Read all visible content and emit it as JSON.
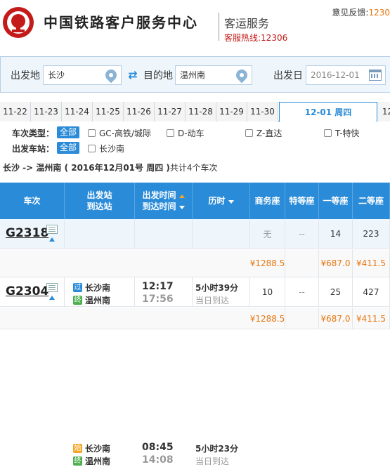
{
  "header": {
    "brand": "中国铁路客户服务中心",
    "sub_title": "客运服务",
    "hotline": "客服热线:12306",
    "feedback_label": "意见反馈:",
    "feedback_value": "1230"
  },
  "search": {
    "from_label": "出发地",
    "from_value": "长沙",
    "to_label": "目的地",
    "to_value": "温州南",
    "date_label": "出发日",
    "date_value": "2016-12-01",
    "swap_icon": "⇄"
  },
  "date_tabs": [
    "11-22",
    "11-23",
    "11-24",
    "11-25",
    "11-26",
    "11-27",
    "11-28",
    "11-29",
    "11-30",
    "12-01  周四",
    "12"
  ],
  "filters": {
    "type_title": "车次类型：",
    "type_all": "全部",
    "type_options": [
      "GC-高铁/城际",
      "D-动车",
      "Z-直达",
      "T-特快"
    ],
    "station_title": "出发车站：",
    "station_all": "全部",
    "station_options": [
      "长沙南"
    ]
  },
  "summary": {
    "route": "长沙 -> 温州南 ( 2016年12月01号  周四 )",
    "count": "共计4个车次"
  },
  "table": {
    "headers": {
      "train": "车次",
      "station_1": "出发站",
      "station_2": "到达站",
      "time_1": "出发时间",
      "time_2": "到达时间",
      "duration": "历时",
      "business": "商务座",
      "premium": "特等座",
      "first": "一等座",
      "second": "二等座"
    },
    "rows": [
      {
        "train": "G2318",
        "from_badge": "始",
        "from": "长沙南",
        "to_badge": "终",
        "to": "温州南",
        "depart": "08:45",
        "arrive": "14:08",
        "duration": "5小时23分",
        "arrival_day": "当日到达",
        "business": "无",
        "premium": "--",
        "first": "14",
        "second": "223",
        "prices": {
          "business": "¥1288.5",
          "first": "¥687.0",
          "second": "¥411.5"
        }
      },
      {
        "train": "G2304",
        "from_badge": "过",
        "from": "长沙南",
        "to_badge": "终",
        "to": "温州南",
        "depart": "12:17",
        "arrive": "17:56",
        "duration": "5小时39分",
        "arrival_day": "当日到达",
        "business": "10",
        "premium": "--",
        "first": "25",
        "second": "427",
        "prices": {
          "business": "¥1288.5",
          "first": "¥687.0",
          "second": "¥411.5"
        }
      }
    ]
  }
}
